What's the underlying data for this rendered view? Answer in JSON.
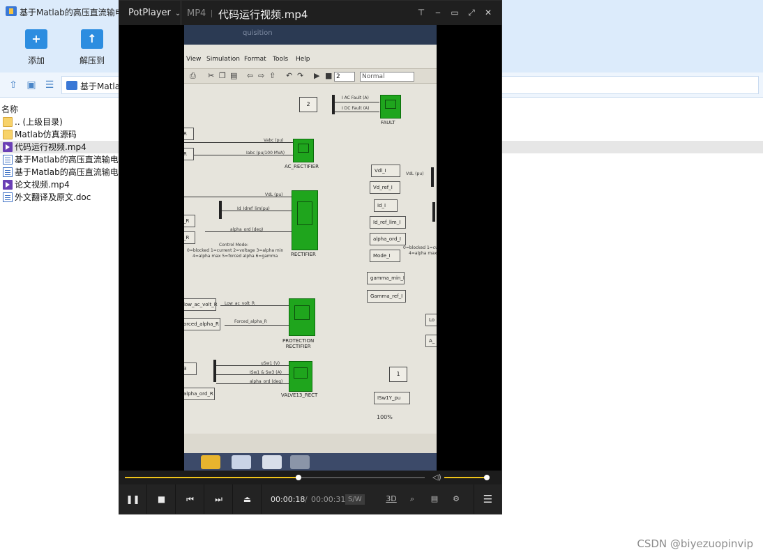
{
  "archive": {
    "title": "基于Matlab的高压直流输电",
    "toolbar": [
      {
        "label": "添加",
        "icon": "add-archive-icon"
      },
      {
        "label": "解压到",
        "icon": "extract-icon"
      }
    ],
    "address": "基于Matla",
    "list_header": "名称",
    "files": [
      {
        "name": ".. (上级目录)",
        "type": "folder"
      },
      {
        "name": "Matlab仿真源码",
        "type": "folder"
      },
      {
        "name": "代码运行视频.mp4",
        "type": "video",
        "selected": true
      },
      {
        "name": "基于Matlab的高压直流输电",
        "type": "doc"
      },
      {
        "name": "基于Matlab的高压直流输电",
        "type": "doc"
      },
      {
        "name": "论文视频.mp4",
        "type": "video"
      },
      {
        "name": "外文翻译及原文.doc",
        "type": "doc"
      }
    ]
  },
  "player": {
    "brand": "PotPlayer",
    "format": "MP4",
    "filename": "代码运行视频.mp4",
    "window_buttons": [
      "pin-icon",
      "minimize-icon",
      "maximize-icon",
      "fullscreen-icon",
      "close-icon"
    ],
    "video": {
      "top_slice": "quisition",
      "menu": [
        "View",
        "Simulation",
        "Format",
        "Tools",
        "Help"
      ],
      "sim_time": "2",
      "sim_mode": "Normal",
      "zoom": "100%",
      "blocks": {
        "fault": "FAULT",
        "ac_rectifier": "AC_RECTIFIER",
        "rectifier": "RECTIFIER",
        "protection": "PROTECTION\nRECTIFIER",
        "valve": "VALVE13_RECT"
      },
      "signals": {
        "iac_fault": "I AC Fault (A)",
        "idc_fault": "I DC Fault (A)",
        "vabc": "Vabc (pu)",
        "iabc": "Iabc (pu/100 MVA)",
        "vdl": "VdL (pu)",
        "id_ref": "Id_Idref_lim(pu)",
        "alpha_ord": "alpha_ord (deg)",
        "control_mode": "Control Mode:",
        "mode_text_1": "0=blocked  1=current 2=voltage 3=alpha min",
        "mode_text_2": "4=alpha max 5=forced alpha 6=gamma",
        "low_ac_volt": "Low_ac_volt_R",
        "forced_alpha": "Forced_alpha_R",
        "usw1": "uSw1 (V)",
        "isw1": "ISw1 & Sw3 (A)",
        "alpha_ord_deg": "alpha_ord (deg)",
        "const_2": "2",
        "const_3": "3",
        "const_1": "1"
      },
      "right_tags": [
        "Vdl_I",
        "Vd_ref_I",
        "Id_I",
        "Id_ref_lim_I",
        "alpha_ord_I",
        "Mode_I",
        "gamma_min_I",
        "Gamma_ref_I",
        "ISw1Y_pu"
      ],
      "right_notes": {
        "vdl": "VdL (pu)",
        "mode_1": "0=blocked  1=cu",
        "mode_2": "4=alpha max"
      },
      "left_tags": [
        "R",
        "R",
        "_R",
        "_R",
        "low_ac_volt_R",
        "orced_alpha_R",
        "3",
        "alpha_ord_R"
      ]
    },
    "seek_fraction": 0.58,
    "volume_fraction": 0.95,
    "controls": {
      "time_current": "00:00:18",
      "time_separator": "/",
      "time_total": "00:00:31",
      "sw_badge": "S/W",
      "three_d": "3D"
    }
  },
  "watermark": "CSDN @biyezuopinvip"
}
